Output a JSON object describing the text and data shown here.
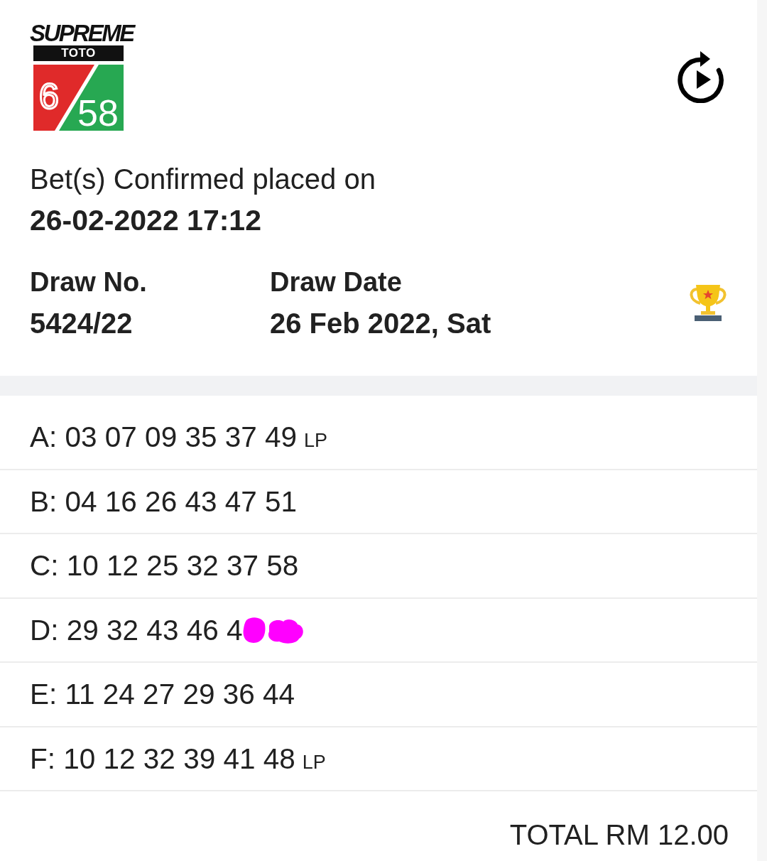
{
  "logo": {
    "brand": "SUPREME",
    "product": "TOTO",
    "left_number": "6",
    "right_number": "58"
  },
  "confirmation": {
    "label": "Bet(s) Confirmed placed on",
    "datetime": "26-02-2022 17:12"
  },
  "draw": [
    {
      "label": "Draw No.",
      "value": "5424/22"
    },
    {
      "label": "Draw Date",
      "value": "26 Feb 2022, Sat"
    }
  ],
  "bets": [
    {
      "text": "A: 03 07 09 35 37 49",
      "tag": "LP",
      "redacted": false
    },
    {
      "text": "B: 04 16 26 43 47 51",
      "redacted": false
    },
    {
      "text": "C: 10 12 25 32 37 58",
      "redacted": false
    },
    {
      "text": "D: 29 32 43 46 4",
      "redacted": true
    },
    {
      "text": "E: 11 24 27 29 36 44",
      "redacted": false
    },
    {
      "text": "F: 10 12 32 39 41 48",
      "tag": "LP",
      "redacted": false
    }
  ],
  "total": "TOTAL RM 12.00"
}
